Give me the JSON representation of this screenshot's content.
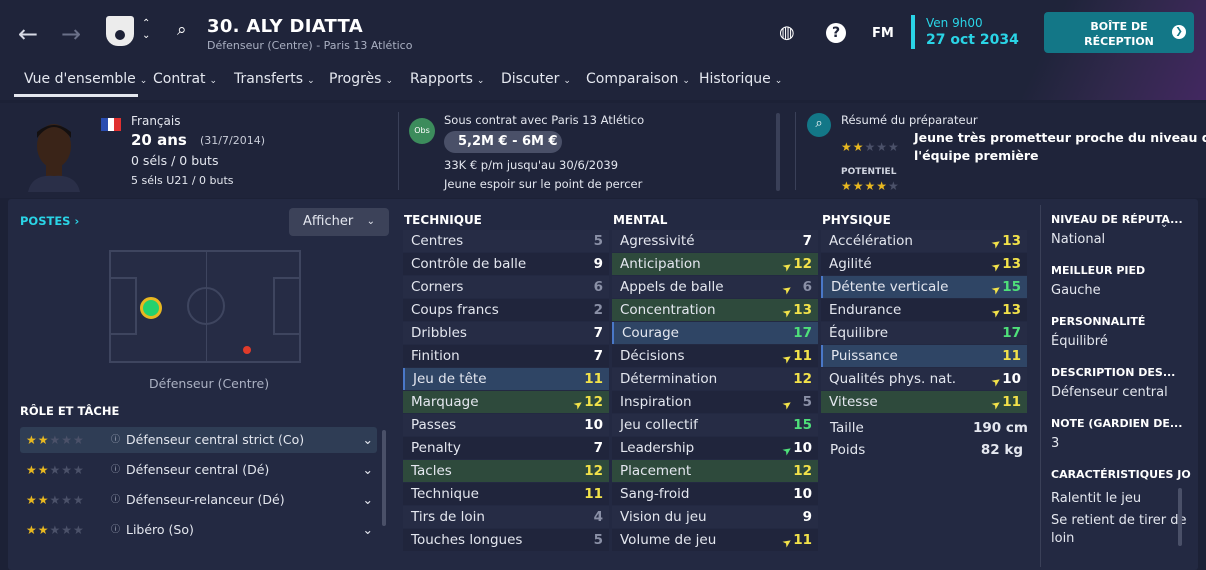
{
  "header": {
    "title": "30. ALY DIATTA",
    "subtitle": "Défenseur (Centre) - Paris 13 Atlético",
    "fm": "FM",
    "date_line1": "Ven 9h00",
    "date_line2": "27 oct 2034",
    "inbox_label": "BOÎTE DE RÉCEPTION"
  },
  "nav": [
    "Vue d'ensemble",
    "Contrat",
    "Transferts",
    "Progrès",
    "Rapports",
    "Discuter",
    "Comparaison",
    "Historique"
  ],
  "info": {
    "nationality": "Français",
    "age": "20 ans",
    "dob": "(31/7/2014)",
    "caps": "0 séls / 0 buts",
    "u21": "5 séls U21 / 0 buts",
    "obs": "Obs",
    "contract": "Sous contrat avec Paris 13 Atlético",
    "value": "5,2M € - 6M €",
    "wage": "33K € p/m jusqu'au 30/6/2039",
    "status": "Jeune espoir sur le point de percer",
    "scout_title": "Résumé du préparateur",
    "scout_text1": "Jeune très prometteur proche du niveau de",
    "scout_text2": "l'équipe première",
    "potential": "POTENTIEL"
  },
  "positions": {
    "title": "POSTES",
    "show": "Afficher",
    "label": "Défenseur (Centre)",
    "roles_title": "RÔLE ET TÂCHE",
    "roles": [
      "Défenseur central strict (Co)",
      "Défenseur central (Dé)",
      "Défenseur-relanceur (Dé)",
      "Libéro (So)"
    ]
  },
  "technique": {
    "title": "TECHNIQUE",
    "rows": [
      [
        "Centres",
        "5"
      ],
      [
        "Contrôle de balle",
        "9"
      ],
      [
        "Corners",
        "6"
      ],
      [
        "Coups francs",
        "2"
      ],
      [
        "Dribbles",
        "7"
      ],
      [
        "Finition",
        "7"
      ],
      [
        "Jeu de tête",
        "11"
      ],
      [
        "Marquage",
        "12"
      ],
      [
        "Passes",
        "10"
      ],
      [
        "Penalty",
        "7"
      ],
      [
        "Tacles",
        "12"
      ],
      [
        "Technique",
        "11"
      ],
      [
        "Tirs de loin",
        "4"
      ],
      [
        "Touches longues",
        "5"
      ]
    ]
  },
  "mental": {
    "title": "MENTAL",
    "rows": [
      [
        "Agressivité",
        "7"
      ],
      [
        "Anticipation",
        "12"
      ],
      [
        "Appels de balle",
        "6"
      ],
      [
        "Concentration",
        "13"
      ],
      [
        "Courage",
        "17"
      ],
      [
        "Décisions",
        "11"
      ],
      [
        "Détermination",
        "12"
      ],
      [
        "Inspiration",
        "5"
      ],
      [
        "Jeu collectif",
        "15"
      ],
      [
        "Leadership",
        "10"
      ],
      [
        "Placement",
        "12"
      ],
      [
        "Sang-froid",
        "10"
      ],
      [
        "Vision du jeu",
        "9"
      ],
      [
        "Volume de jeu",
        "11"
      ]
    ]
  },
  "physique": {
    "title": "PHYSIQUE",
    "rows": [
      [
        "Accélération",
        "13"
      ],
      [
        "Agilité",
        "13"
      ],
      [
        "Détente verticale",
        "15"
      ],
      [
        "Endurance",
        "13"
      ],
      [
        "Équilibre",
        "17"
      ],
      [
        "Puissance",
        "11"
      ],
      [
        "Qualités phys. nat.",
        "10"
      ],
      [
        "Vitesse",
        "11"
      ]
    ],
    "height_label": "Taille",
    "height": "190 cm",
    "weight_label": "Poids",
    "weight": "82 kg"
  },
  "side": {
    "rep_h": "NIVEAU DE RÉPUTA...",
    "rep_v": "National",
    "foot_h": "MEILLEUR PIED",
    "foot_v": "Gauche",
    "pers_h": "PERSONNALITÉ",
    "pers_v": "Équilibré",
    "desc_h": "DESCRIPTION DES...",
    "desc_v": "Défenseur central",
    "note_h": "NOTE (GARDIEN DE...",
    "note_v": "3",
    "car_h": "CARACTÉRISTIQUES JO",
    "car_v1": "Ralentit le jeu",
    "car_v2": "Se retient de tirer de",
    "car_v3": "loin"
  },
  "colors": {
    "accent": "#2ad4e6",
    "green_hl": "#2e4a3c",
    "blue_hl": "#2f4565",
    "value_yellow": "#f2e24a",
    "value_green": "#4fe07a"
  }
}
